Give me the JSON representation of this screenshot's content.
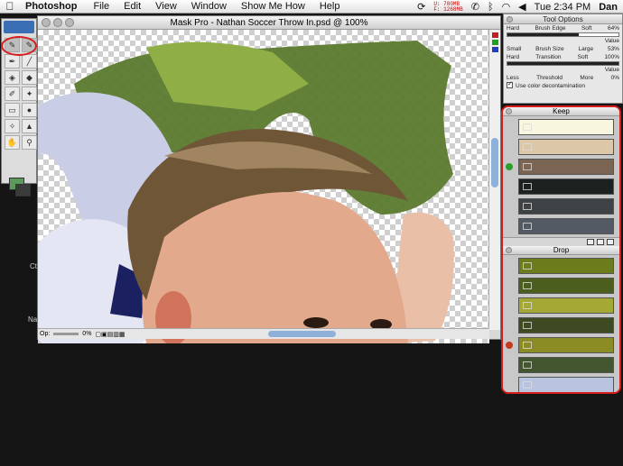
{
  "menubar": {
    "app": "Photoshop",
    "items": [
      "File",
      "Edit",
      "View",
      "Window",
      "Show Me How",
      "Help"
    ],
    "memory": [
      "U: 780MB",
      "F: 1268MB"
    ],
    "clock": "Tue 2:34 PM",
    "user": "Dan"
  },
  "desktop": {
    "labels": [
      "Ct",
      "Na"
    ]
  },
  "document": {
    "title": "Mask Pro - Nathan Soccer Throw In.psd @ 100%",
    "status": {
      "zoom_label": "Op:",
      "percent": "0%"
    }
  },
  "tool_options": {
    "title": "Tool Options",
    "row1": {
      "left": "Hard",
      "center": "Brush Edge",
      "right": "Soft",
      "value": "64%"
    },
    "row1b": {
      "value_label": "Value"
    },
    "row2": {
      "left": "Small",
      "center": "Brush Size",
      "right": "Large",
      "value": "53%"
    },
    "row3": {
      "left": "Hard",
      "center": "Transition",
      "right": "Soft",
      "value": "100%"
    },
    "row3b": {
      "value_label": "Value"
    },
    "row4": {
      "left": "Less",
      "center": "Threshold",
      "right": "More",
      "value": "0%"
    },
    "checkbox_label": "Use color decontamination"
  },
  "keep_panel": {
    "title": "Keep",
    "swatches": [
      "#f8f6de",
      "#dcc8a8",
      "#7a6452",
      "#1c2220",
      "#3e4244",
      "#545a64"
    ]
  },
  "drop_panel": {
    "title": "Drop",
    "swatches": [
      "#6c7c1c",
      "#4c5e1e",
      "#a4a834",
      "#3e4a22",
      "#8c8c24",
      "#445630",
      "#b8c4e0"
    ]
  },
  "colors": {
    "highlight": "#d81c1c",
    "keep_indicator": "#2aa02a",
    "drop_indicator": "#c43a1a"
  }
}
